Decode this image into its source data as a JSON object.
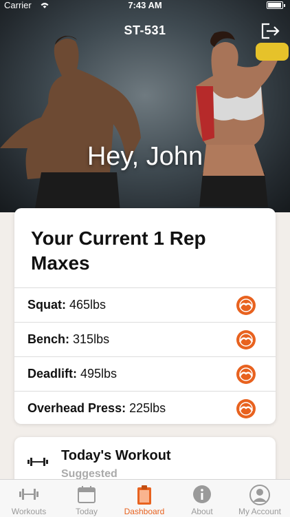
{
  "status_bar": {
    "carrier": "Carrier",
    "time": "7:43 AM"
  },
  "header": {
    "title": "ST-531",
    "greeting": "Hey, John"
  },
  "maxes_card": {
    "title": "Your Current 1 Rep Maxes",
    "rows": [
      {
        "lift": "Squat:",
        "value": "465lbs",
        "icon": "orange-dial-icon"
      },
      {
        "lift": "Bench:",
        "value": "315lbs",
        "icon": "orange-dial-icon"
      },
      {
        "lift": "Deadlift:",
        "value": "495lbs",
        "icon": "orange-dial-icon"
      },
      {
        "lift": "Overhead Press:",
        "value": "225lbs",
        "icon": "orange-dial-icon"
      }
    ]
  },
  "workout_card": {
    "title": "Today's Workout",
    "subtitle": "Suggested",
    "icon": "dumbbell-icon"
  },
  "tabs": [
    {
      "label": "Workouts",
      "icon": "dumbbell-icon"
    },
    {
      "label": "Today",
      "icon": "calendar-icon"
    },
    {
      "label": "Dashboard",
      "icon": "clipboard-icon",
      "active": true
    },
    {
      "label": "About",
      "icon": "info-icon"
    },
    {
      "label": "My Account",
      "icon": "user-icon"
    }
  ],
  "colors": {
    "accent": "#e8621f",
    "inactive": "#9a9a9a"
  }
}
